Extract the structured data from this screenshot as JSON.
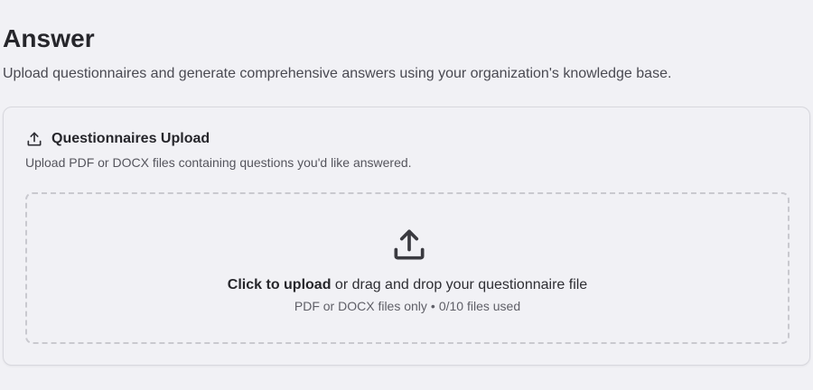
{
  "header": {
    "title": "Answer",
    "subtitle": "Upload questionnaires and generate comprehensive answers using your organization's knowledge base."
  },
  "upload_card": {
    "icon": "upload-icon",
    "title": "Questionnaires Upload",
    "description": "Upload PDF or DOCX files containing questions you'd like answered.",
    "dropzone": {
      "icon": "upload-icon",
      "action_label": "Click to upload",
      "action_rest": " or drag and drop your questionnaire file",
      "file_types": "PDF or DOCX files only",
      "separator": "•",
      "usage": "0/10 files used"
    }
  },
  "colors": {
    "background": "#f1f1f5",
    "border": "#d8d8de",
    "dashed_border": "#c9c9cf",
    "text_primary": "#26262b",
    "icon": "#3a3a40"
  }
}
